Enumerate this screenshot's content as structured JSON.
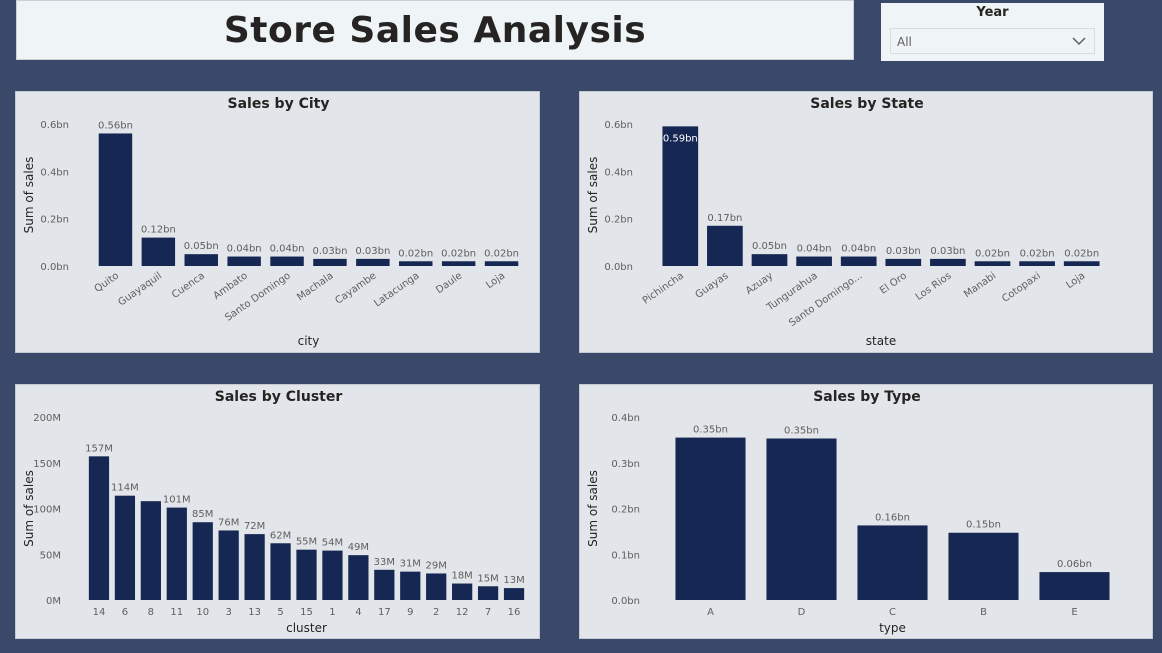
{
  "page": {
    "title": "Store Sales Analysis",
    "slicer": {
      "label": "Year",
      "value": "All"
    }
  },
  "colors": {
    "background": "#3a4869",
    "bar": "#152752",
    "panel": "#e2e6ea"
  },
  "chart_data": [
    {
      "id": "city",
      "type": "bar",
      "title": "Sales by City",
      "xlabel": "city",
      "ylabel": "Sum of sales",
      "ylim": [
        0,
        0.6
      ],
      "yticks": [
        "0.0bn",
        "0.2bn",
        "0.4bn",
        "0.6bn"
      ],
      "categories": [
        "Quito",
        "Guayaquil",
        "Cuenca",
        "Ambato",
        "Santo Domingo",
        "Machala",
        "Cayambe",
        "Latacunga",
        "Daule",
        "Loja"
      ],
      "values": [
        0.56,
        0.12,
        0.05,
        0.04,
        0.04,
        0.03,
        0.03,
        0.02,
        0.02,
        0.02
      ],
      "labels": [
        "0.56bn",
        "0.12bn",
        "0.05bn",
        "0.04bn",
        "0.04bn",
        "0.03bn",
        "0.03bn",
        "0.02bn",
        "0.02bn",
        "0.02bn"
      ],
      "rotate_labels": true
    },
    {
      "id": "state",
      "type": "bar",
      "title": "Sales by State",
      "xlabel": "state",
      "ylabel": "Sum of sales",
      "ylim": [
        0,
        0.6
      ],
      "yticks": [
        "0.0bn",
        "0.2bn",
        "0.4bn",
        "0.6bn"
      ],
      "categories": [
        "Pichincha",
        "Guayas",
        "Azuay",
        "Tungurahua",
        "Santo Domingo...",
        "El Oro",
        "Los Rios",
        "Manabi",
        "Cotopaxi",
        "Loja"
      ],
      "values": [
        0.59,
        0.17,
        0.05,
        0.04,
        0.04,
        0.03,
        0.03,
        0.02,
        0.02,
        0.02
      ],
      "labels": [
        "0.59bn",
        "0.17bn",
        "0.05bn",
        "0.04bn",
        "0.04bn",
        "0.03bn",
        "0.03bn",
        "0.02bn",
        "0.02bn",
        "0.02bn"
      ],
      "rotate_labels": true,
      "inside_first_label": true
    },
    {
      "id": "cluster",
      "type": "bar",
      "title": "Sales by Cluster",
      "xlabel": "cluster",
      "ylabel": "Sum of sales",
      "ylim": [
        0,
        200
      ],
      "yticks": [
        "0M",
        "50M",
        "100M",
        "150M",
        "200M"
      ],
      "categories": [
        "14",
        "6",
        "8",
        "11",
        "10",
        "3",
        "13",
        "5",
        "15",
        "1",
        "4",
        "17",
        "9",
        "2",
        "12",
        "7",
        "16"
      ],
      "values": [
        157,
        114,
        108,
        101,
        85,
        76,
        72,
        62,
        55,
        54,
        49,
        33,
        31,
        29,
        18,
        15,
        13
      ],
      "labels": [
        "157M",
        "114M",
        "",
        "101M",
        "85M",
        "76M",
        "72M",
        "62M",
        "55M",
        "54M",
        "49M",
        "33M",
        "31M",
        "29M",
        "18M",
        "15M",
        "13M"
      ],
      "rotate_labels": false
    },
    {
      "id": "type",
      "type": "bar",
      "title": "Sales by Type",
      "xlabel": "type",
      "ylabel": "Sum of sales",
      "ylim": [
        0,
        0.4
      ],
      "yticks": [
        "0.0bn",
        "0.1bn",
        "0.2bn",
        "0.3bn",
        "0.4bn"
      ],
      "categories": [
        "A",
        "D",
        "C",
        "B",
        "E"
      ],
      "values": [
        0.355,
        0.353,
        0.163,
        0.147,
        0.061
      ],
      "labels": [
        "0.35bn",
        "0.35bn",
        "0.16bn",
        "0.15bn",
        "0.06bn"
      ],
      "rotate_labels": false
    }
  ]
}
